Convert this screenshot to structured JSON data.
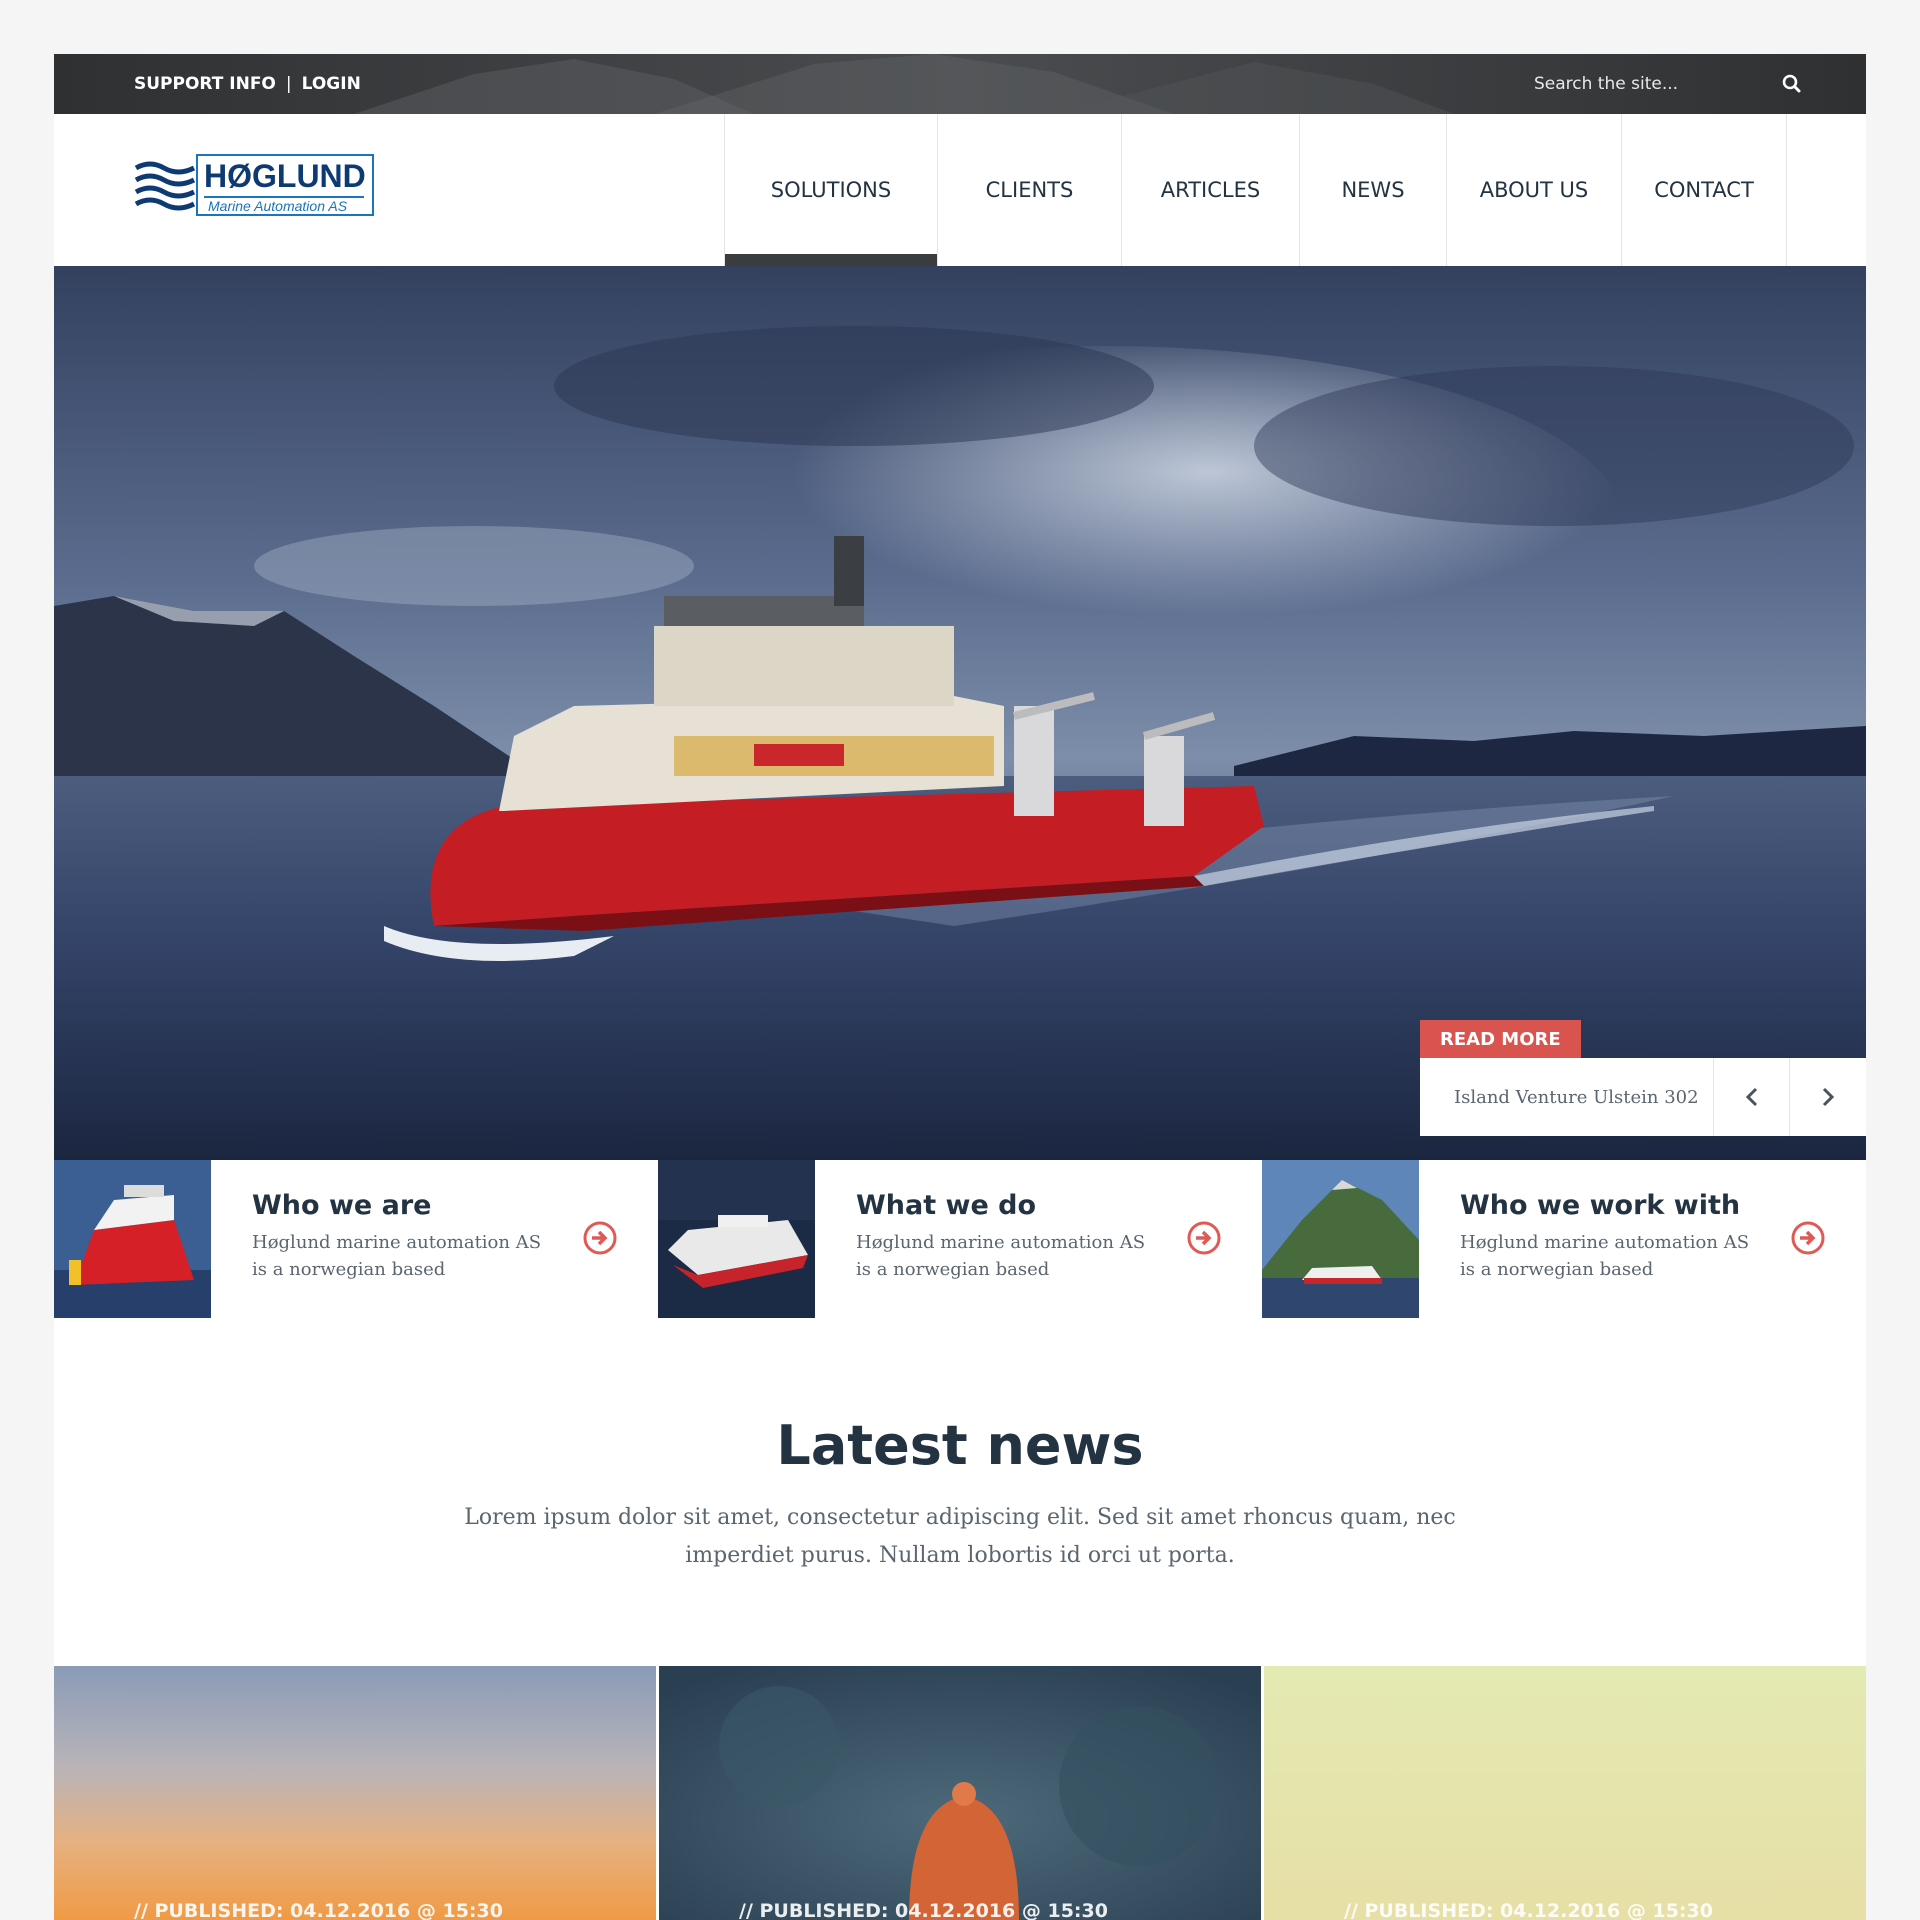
{
  "topbar": {
    "support_label": "SUPPORT INFO",
    "separator": "|",
    "login_label": "LOGIN",
    "search_placeholder": "Search the site..."
  },
  "logo": {
    "name": "HØGLUND",
    "tagline": "Marine Automation AS"
  },
  "nav": {
    "items": [
      {
        "label": "SOLUTIONS",
        "active": true
      },
      {
        "label": "CLIENTS",
        "active": false
      },
      {
        "label": "ARTICLES",
        "active": false
      },
      {
        "label": "NEWS",
        "active": false
      },
      {
        "label": "ABOUT US",
        "active": false
      },
      {
        "label": "CONTACT",
        "active": false
      }
    ]
  },
  "hero": {
    "read_more_label": "READ MORE",
    "caption": "Island Venture Ulstein 302"
  },
  "features": [
    {
      "title": "Who we are",
      "text": "Høglund marine automation AS is a norwegian based"
    },
    {
      "title": "What we do",
      "text": "Høglund marine automation AS is a norwegian based"
    },
    {
      "title": "Who we work with",
      "text": "Høglund marine automation AS is a norwegian based"
    }
  ],
  "latest_news": {
    "heading": "Latest news",
    "intro": "Lorem ipsum dolor sit amet, consectetur adipiscing elit. Sed sit amet rhoncus quam, nec imperdiet purus. Nullam lobortis id orci ut porta.",
    "cards": [
      {
        "published": "// PUBLISHED: 04.12.2016 @ 15:30"
      },
      {
        "published": "// PUBLISHED: 04.12.2016 @ 15:30"
      },
      {
        "published": "// PUBLISHED: 04.12.2016 @ 15:30"
      }
    ]
  },
  "colors": {
    "accent": "#d9534f",
    "text_dark": "#243342",
    "topbar_bg": "#2f3133",
    "brand_blue": "#1b75bb"
  }
}
